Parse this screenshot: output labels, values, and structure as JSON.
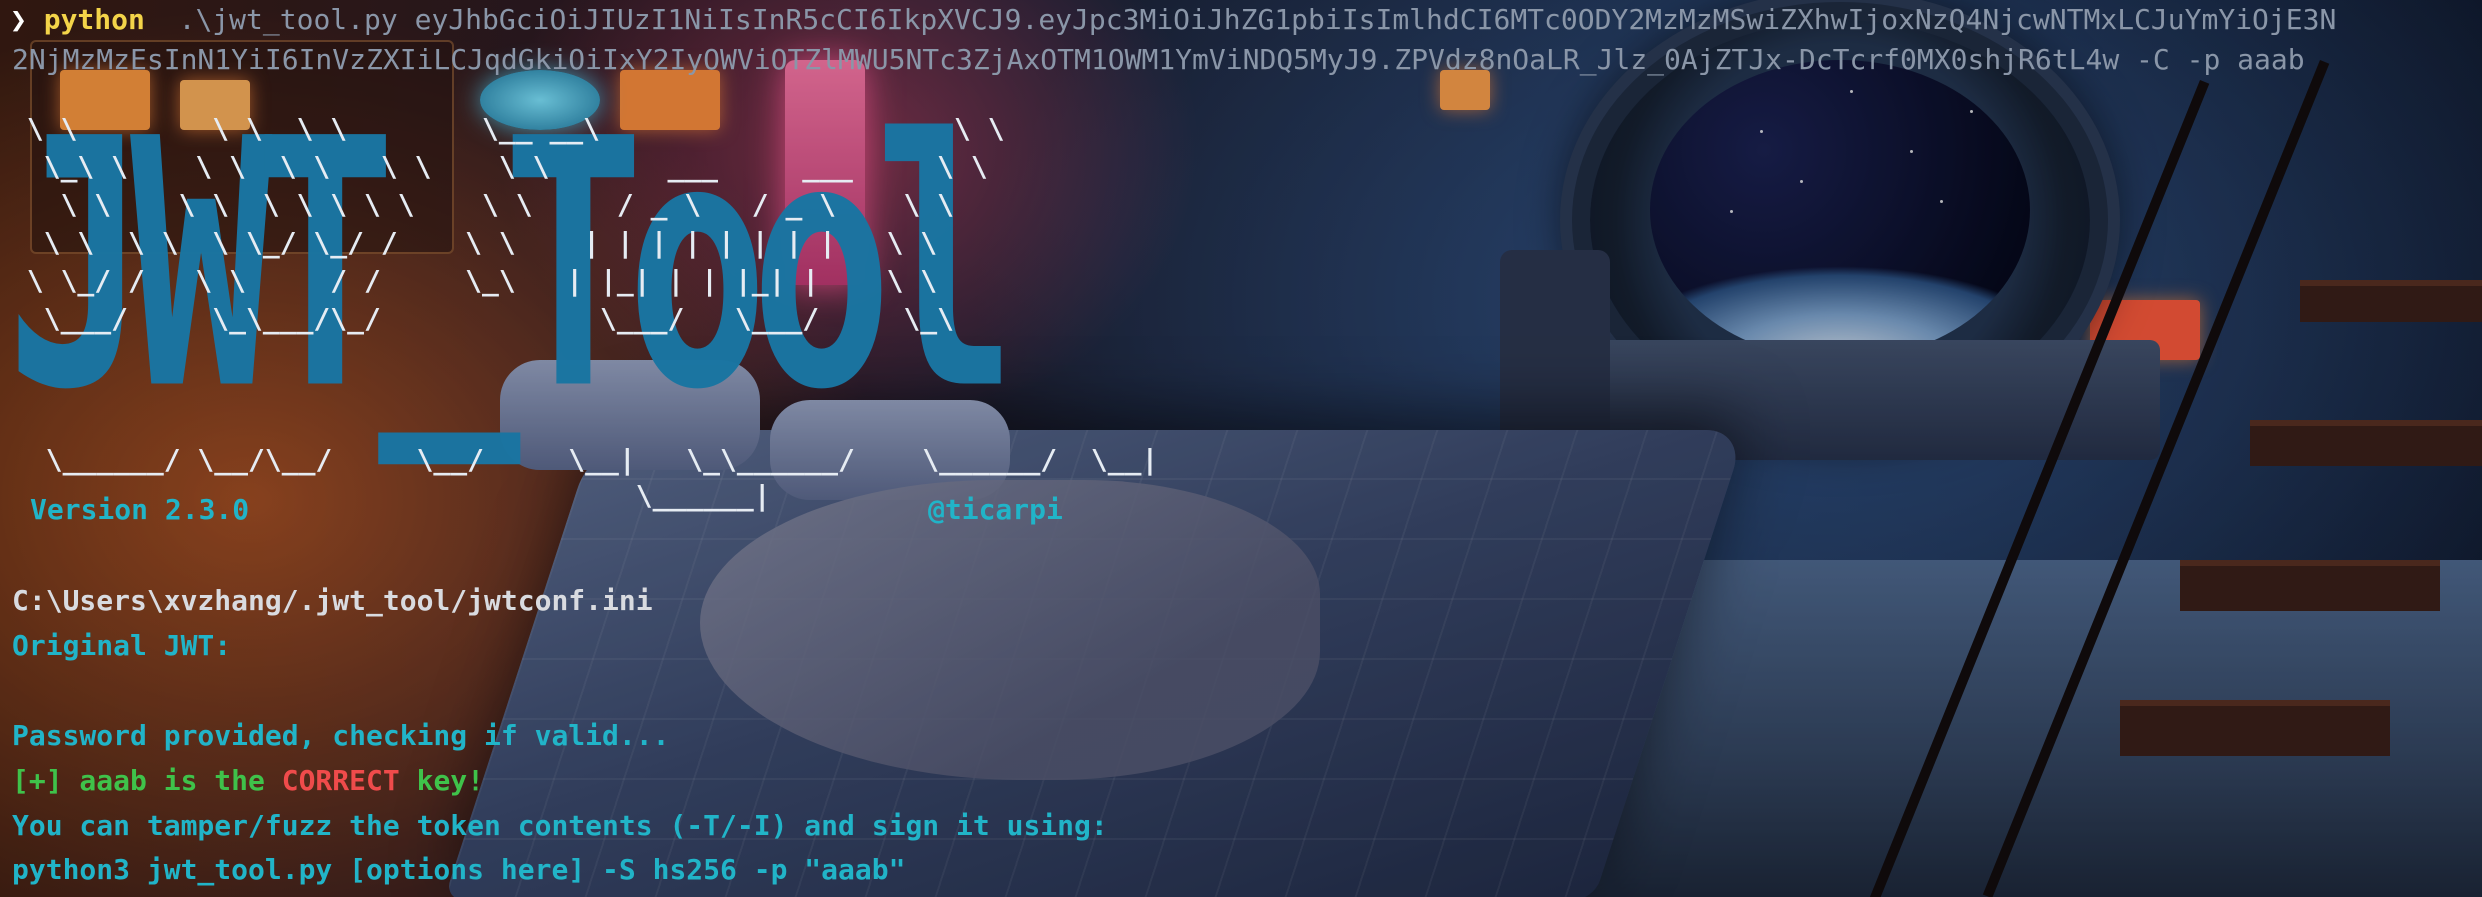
{
  "terminal": {
    "prompt_symbol": "❯",
    "command_program": "python",
    "command_args_line1": "  .\\jwt_tool.py eyJhbGciOiJIUzI1NiIsInR5cCI6IkpXVCJ9.eyJpc3MiOiJhZG1pbiIsImlhdCI6MTc0ODY2MzMzMSwiZXhwIjoxNzQ4NjcwNTMxLCJuYmYiOjE3N",
    "command_args_line2": "2NjMzMzEsInN1YiI6InVzZXIiLCJqdGkiOiIxY2IyOWViOTZlMWU5NTc3ZjAxOTM1OWM1YmViNDQ5MyJ9.ZPVdz8nOaLR_Jlz_0AjZTJx-DcTcrf0MX0shjR6tL4w -C -p aaab"
  },
  "banner": {
    "title": "JWT_Tool",
    "ascii_art_lines": [
      " \\ \\        \\ \\  \\ \\        \\__ __\\                     \\ \\",
      "  \\_\\ \\    \\ \\  \\ \\   \\ \\    \\ \\       ___     ___     \\ \\",
      "   \\ \\    \\ \\  \\ \\ \\ \\ \\    \\ \\     / _ \\   / _ \\    \\ \\",
      "  \\ \\  \\ \\  \\ \\_/ \\_/ /    \\ \\    | | | | | | | |   \\ \\",
      " \\ \\_/ /   \\ \\     / /     \\_\\   | |_| | | |_| |    \\ \\",
      "  \\___/     \\_\\___/\\_/             \\___/   \\___/     \\_\\"
    ],
    "bottom_line": "  \\______/ \\__/\\__/     \\__/     \\__|   \\_\\______/    \\______/  \\__|",
    "underscore_line": "                                     \\______|",
    "version": "Version 2.3.0",
    "author": "@ticarpi"
  },
  "output": {
    "config_path": "C:\\Users\\xvzhang/.jwt_tool/jwtconf.ini",
    "original_jwt_label": "Original JWT:",
    "password_check": "Password provided, checking if valid...",
    "correct_key": "[+] aaab is the CORRECT key!",
    "tamper_hint": "You can tamper/fuzz the token contents (-T/-I) and sign it using:",
    "sign_command": "python3 jwt_tool.py [options here] -S hs256 -p \"aaab\""
  },
  "colors": {
    "cyan": "#21b4c8",
    "green": "#3fc24a",
    "red": "#ef4b4b",
    "yellow": "#f3d449",
    "title_blue": "#1a75a2"
  },
  "background": {
    "description_icon": "space-bedroom-wallpaper"
  }
}
